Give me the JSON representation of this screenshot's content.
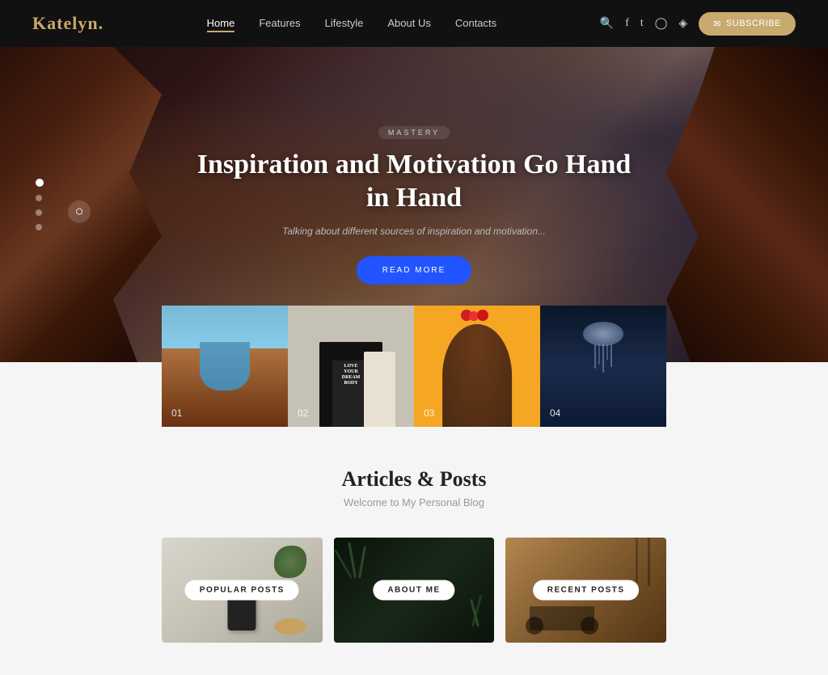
{
  "site": {
    "logo_text": "Katelyn",
    "logo_dot": "."
  },
  "navbar": {
    "links": [
      {
        "label": "Home",
        "active": true
      },
      {
        "label": "Features",
        "active": false
      },
      {
        "label": "Lifestyle",
        "active": false
      },
      {
        "label": "About Us",
        "active": false
      },
      {
        "label": "Contacts",
        "active": false
      }
    ],
    "subscribe_label": "SUBSCRIBE"
  },
  "hero": {
    "tag": "MASTERY",
    "title": "Inspiration and Motivation Go Hand in Hand",
    "subtitle": "Talking about different sources of inspiration and motivation...",
    "cta_label": "READ MORE",
    "slide_numbers": [
      "01",
      "02",
      "03",
      "04"
    ]
  },
  "gallery": {
    "items": [
      {
        "num": "01"
      },
      {
        "num": "02"
      },
      {
        "num": "03"
      },
      {
        "num": "04"
      }
    ]
  },
  "articles": {
    "title": "Articles & Posts",
    "subtitle": "Welcome to My Personal Blog",
    "posts": [
      {
        "label": "POPULAR POSTS"
      },
      {
        "label": "ABOUT ME"
      },
      {
        "label": "RECENT POSTS"
      }
    ]
  }
}
